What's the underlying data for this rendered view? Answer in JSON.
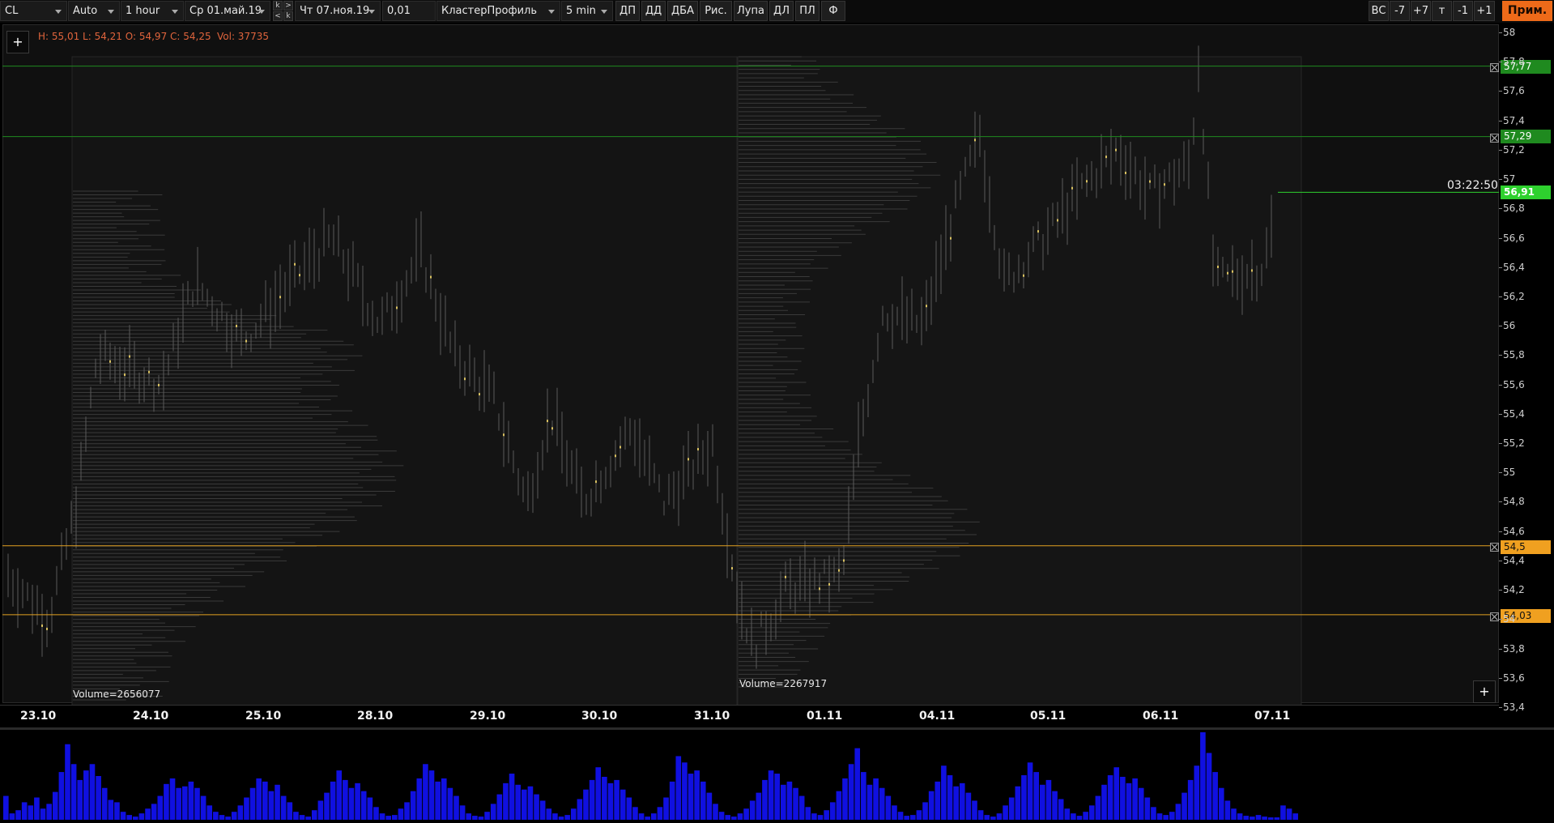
{
  "toolbar": {
    "symbol": "CL",
    "scale": "Auto",
    "timeframe": "1 hour",
    "date_from": "Ср 01.май.19",
    "date_to": "Чт 07.ноя.19",
    "tick_size": "0,01",
    "chart_type": "КластерПрофиль",
    "cluster_tf": "5 min",
    "nav_k_top": "k",
    "nav_gt": ">",
    "nav_lt": "<",
    "nav_k_bottom": "k",
    "buttons": [
      "ДП",
      "ДД",
      "ДБА",
      "Рис.",
      "Лупа",
      "ДЛ",
      "ПЛ",
      "Ф"
    ],
    "right_buttons": [
      "ВС",
      "-7",
      "+7",
      "т",
      "-1",
      "+1"
    ],
    "apply": "Прим."
  },
  "info": {
    "ohlc": "H: 55,01  L: 54,21  O: 54,97  C: 54,25",
    "vol": "Vol: 37735",
    "add": "+"
  },
  "profiles": [
    {
      "label": "Volume=2656077"
    },
    {
      "label": "Volume=2267917"
    }
  ],
  "countdown": "03:22:50",
  "price_labels": {
    "current": "56,91",
    "line_5777": "57,77",
    "line_5729": "57,29",
    "line_545": "54,5",
    "line_5403": "54,03"
  },
  "colors": {
    "green_line": "#1f8a1f",
    "orange_line": "#e2a020",
    "current_price": "#2ed12e",
    "volume_bars": "#1010e0",
    "accent": "#ee6a19"
  },
  "chart_data": {
    "type": "bar",
    "y_axis_ticks": [
      "58",
      "57,8",
      "57,6",
      "57,4",
      "57,2",
      "57",
      "56,8",
      "56,6",
      "56,4",
      "56,2",
      "56",
      "55,8",
      "55,6",
      "55,4",
      "55,2",
      "55",
      "54,8",
      "54,6",
      "54,4",
      "54,2",
      "54",
      "53,8",
      "53,6",
      "53,4"
    ],
    "ylim": [
      53.4,
      58.0
    ],
    "x_labels": [
      "23.10",
      "24.10",
      "25.10",
      "28.10",
      "29.10",
      "30.10",
      "31.10",
      "01.11",
      "04.11",
      "05.11",
      "06.11",
      "07.11"
    ],
    "horizontal_lines": [
      57.77,
      57.29,
      54.5,
      54.03
    ],
    "current_price": 56.91,
    "volume_bars": [
      30,
      8,
      12,
      22,
      18,
      28,
      14,
      20,
      35,
      60,
      95,
      70,
      50,
      62,
      70,
      55,
      40,
      25,
      22,
      10,
      6,
      4,
      8,
      14,
      20,
      30,
      45,
      52,
      40,
      42,
      48,
      40,
      30,
      18,
      10,
      6,
      4,
      10,
      18,
      28,
      40,
      52,
      48,
      36,
      44,
      30,
      22,
      10,
      6,
      4,
      12,
      24,
      34,
      48,
      62,
      50,
      40,
      46,
      36,
      28,
      16,
      8,
      5,
      6,
      14,
      22,
      36,
      52,
      70,
      62,
      48,
      52,
      40,
      30,
      18,
      8,
      5,
      4,
      10,
      20,
      32,
      46,
      58,
      44,
      38,
      42,
      32,
      24,
      14,
      8,
      4,
      6,
      14,
      26,
      38,
      50,
      66,
      54,
      46,
      50,
      38,
      28,
      16,
      8,
      4,
      8,
      16,
      28,
      48,
      80,
      72,
      58,
      62,
      48,
      34,
      20,
      10,
      6,
      4,
      8,
      14,
      24,
      34,
      50,
      62,
      58,
      44,
      48,
      40,
      30,
      16,
      8,
      6,
      12,
      22,
      36,
      52,
      70,
      90,
      60,
      44,
      52,
      40,
      30,
      18,
      10,
      5,
      6,
      12,
      22,
      36,
      48,
      68,
      56,
      42,
      46,
      34,
      24,
      12,
      6,
      4,
      8,
      18,
      28,
      42,
      56,
      72,
      60,
      44,
      50,
      36,
      26,
      14,
      8,
      5,
      10,
      18,
      30,
      44,
      56,
      66,
      54,
      46,
      52,
      40,
      28,
      16,
      8,
      6,
      10,
      20,
      34,
      50,
      68,
      110,
      84,
      60,
      40,
      24,
      14,
      8,
      5,
      4,
      6,
      4,
      3,
      3,
      18,
      14,
      8
    ]
  }
}
